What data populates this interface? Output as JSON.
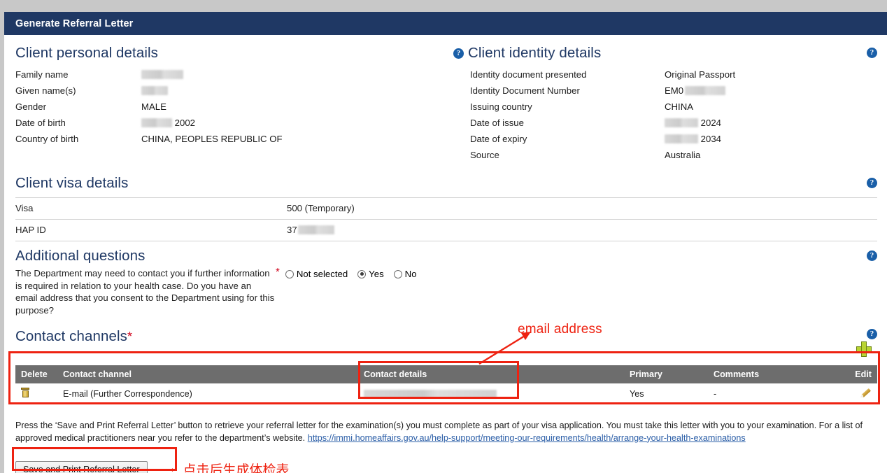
{
  "window": {
    "title": "Generate Referral Letter"
  },
  "icons": {
    "help": "?",
    "plus": "add-contact-channel",
    "trash": "delete-icon",
    "pencil": "edit-icon"
  },
  "colors": {
    "header_bg": "#1f3864",
    "heading": "#1f3864",
    "table_header_bg": "#6d6d6d",
    "annotation_red": "#ee2211",
    "link": "#2b5ea7",
    "required_star": "#d0021b",
    "plus_green": "#b9d432"
  },
  "personal": {
    "heading": "Client personal details",
    "fields": [
      {
        "label": "Family name",
        "value": "",
        "masked": true,
        "mask_width": 60
      },
      {
        "label": "Given name(s)",
        "value": "",
        "masked": true,
        "mask_width": 38
      },
      {
        "label": "Gender",
        "value": "MALE",
        "masked": false
      },
      {
        "label": "Date of birth",
        "value": "2002",
        "masked": true,
        "mask_width": 44
      },
      {
        "label": "Country of birth",
        "value": "CHINA, PEOPLES REPUBLIC OF",
        "masked": false
      }
    ]
  },
  "identity": {
    "heading": "Client identity details",
    "fields": [
      {
        "label": "Identity document presented",
        "value": "Original Passport",
        "masked": false
      },
      {
        "label": "Identity Document Number",
        "value": "EM0",
        "masked": true,
        "mask_width": 58,
        "mask_after": true
      },
      {
        "label": "Issuing country",
        "value": "CHINA",
        "masked": false
      },
      {
        "label": "Date of issue",
        "value": "2024",
        "masked": true,
        "mask_width": 48
      },
      {
        "label": "Date of expiry",
        "value": "2034",
        "masked": true,
        "mask_width": 48
      },
      {
        "label": "Source",
        "value": "Australia",
        "masked": false
      }
    ]
  },
  "visa": {
    "heading": "Client visa details",
    "rows": [
      {
        "label": "Visa",
        "value": "500 (Temporary)",
        "masked": false
      },
      {
        "label": "HAP ID",
        "value": "37",
        "masked": true,
        "mask_width": 52,
        "mask_after": true
      }
    ]
  },
  "additional": {
    "heading": "Additional questions",
    "question": "The Department may need to contact you if further information is required in relation to your health case. Do you have an email address that you consent to the Department using for this purpose?",
    "options": [
      {
        "label": "Not selected",
        "selected": false
      },
      {
        "label": "Yes",
        "selected": true
      },
      {
        "label": "No",
        "selected": false
      }
    ]
  },
  "contact": {
    "heading": "Contact channels",
    "required_marker": "*",
    "columns": [
      "Delete",
      "Contact channel",
      "Contact details",
      "Primary",
      "Comments",
      "Edit"
    ],
    "rows": [
      {
        "channel": "E-mail (Further Correspondence)",
        "details": "",
        "details_masked": true,
        "primary": "Yes",
        "comments": "-"
      }
    ]
  },
  "annotations": {
    "email_address": "email address",
    "button_note": "点击后生成体检表",
    "arrow": "→"
  },
  "footer": {
    "paragraph_part1": "Press the ‘Save and Print Referral Letter’ button to retrieve your referral letter for the examination(s) you must complete as part of your visa application. You must take this letter with you to your examination. For a list of approved medical practitioners near you refer to the department’s website. ",
    "link": "https://immi.homeaffairs.gov.au/help-support/meeting-our-requirements/health/arrange-your-health-examinations",
    "save_button": "Save and Print Referral Letter"
  }
}
